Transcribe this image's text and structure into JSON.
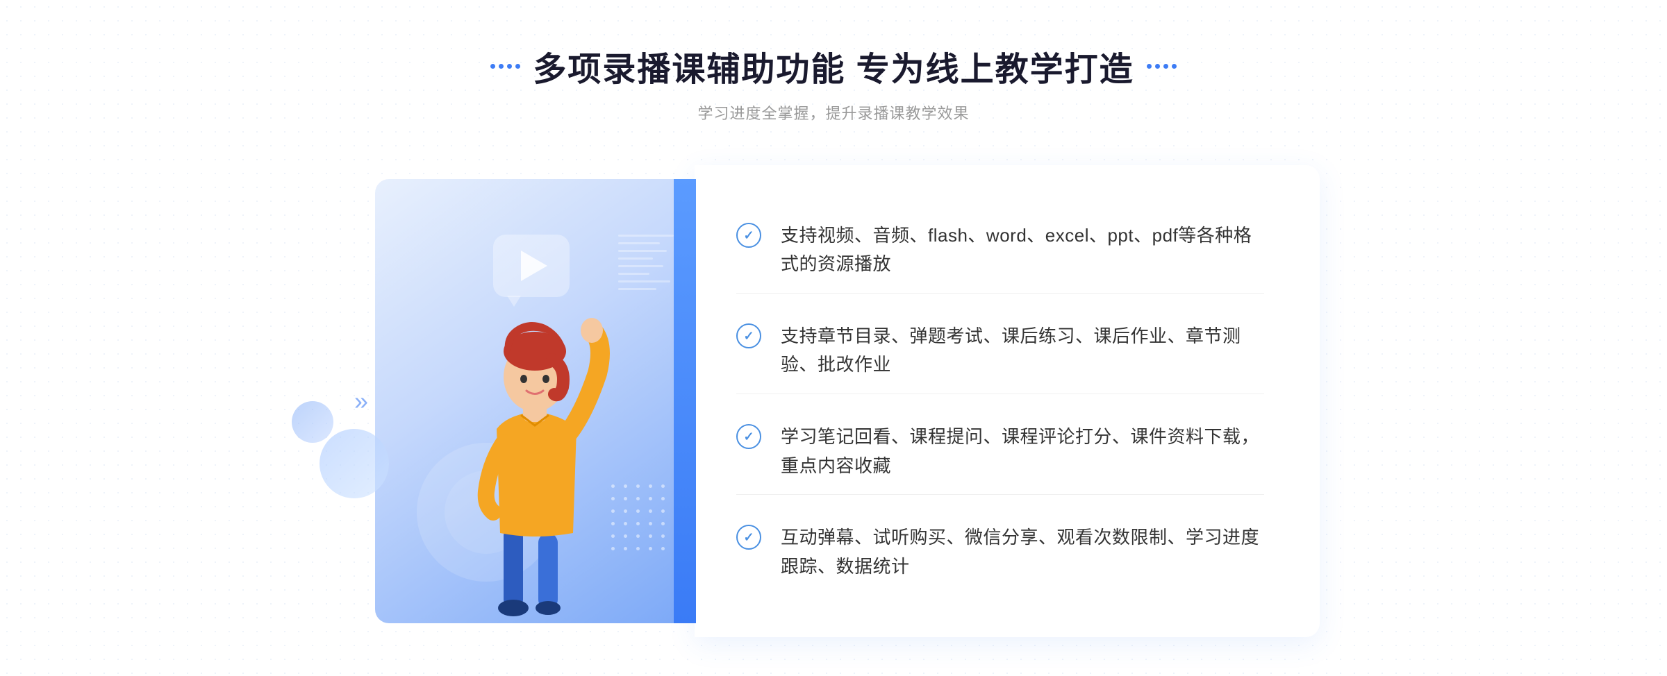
{
  "page": {
    "background": "#ffffff"
  },
  "header": {
    "title": "多项录播课辅助功能 专为线上教学打造",
    "subtitle": "学习进度全掌握，提升录播课教学效果",
    "title_dots_left": "decorative",
    "title_dots_right": "decorative"
  },
  "features": [
    {
      "id": 1,
      "text": "支持视频、音频、flash、word、excel、ppt、pdf等各种格式的资源播放"
    },
    {
      "id": 2,
      "text": "支持章节目录、弹题考试、课后练习、课后作业、章节测验、批改作业"
    },
    {
      "id": 3,
      "text": "学习笔记回看、课程提问、课程评论打分、课件资料下载，重点内容收藏"
    },
    {
      "id": 4,
      "text": "互动弹幕、试听购买、微信分享、观看次数限制、学习进度跟踪、数据统计"
    }
  ],
  "illustration": {
    "play_button": "▶",
    "left_arrow": "»"
  },
  "colors": {
    "primary_blue": "#3d7cf5",
    "light_blue": "#7ba8f7",
    "text_dark": "#1a1a2e",
    "text_medium": "#333333",
    "text_light": "#999999"
  }
}
